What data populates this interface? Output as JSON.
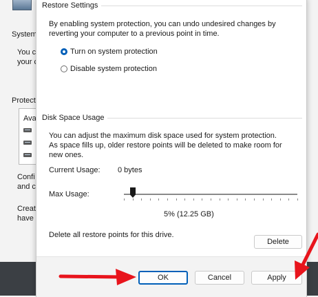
{
  "parent": {
    "fragments": [
      "System",
      "You ca",
      "your co",
      "Protecti",
      "Ava",
      "Confi",
      "and c",
      "Creat",
      "have"
    ]
  },
  "dialog": {
    "restore_settings": {
      "title": "Restore Settings",
      "description": "By enabling system protection, you can undo undesired changes by reverting your computer to a previous point in time.",
      "options": [
        {
          "label": "Turn on system protection",
          "selected": true
        },
        {
          "label": "Disable system protection",
          "selected": false
        }
      ]
    },
    "disk_space": {
      "title": "Disk Space Usage",
      "description": "You can adjust the maximum disk space used for system protection. As space fills up, older restore points will be deleted to make room for new ones.",
      "current_usage_label": "Current Usage:",
      "current_usage_value": "0 bytes",
      "max_usage_label": "Max Usage:",
      "slider_fraction": 0.05,
      "max_usage_value": "5% (12.25 GB)",
      "delete_text": "Delete all restore points for this drive.",
      "delete_button": "Delete"
    },
    "buttons": {
      "ok": "OK",
      "cancel": "Cancel",
      "apply": "Apply"
    }
  },
  "colors": {
    "accent": "#005fb8",
    "arrow": "#e8141c"
  }
}
